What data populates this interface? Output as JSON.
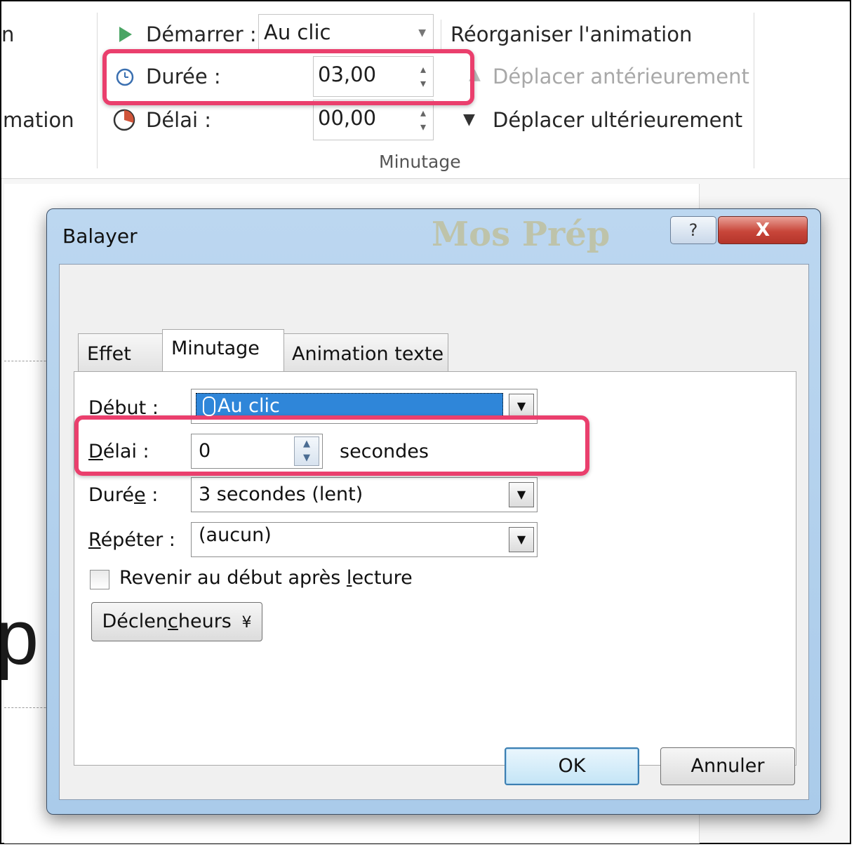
{
  "ribbon": {
    "left_group_label_partial": "n",
    "left_group_text_partial": "mation",
    "start_label": "Démarrer :",
    "start_value": "Au clic",
    "duration_label": "Durée :",
    "duration_value": "03,00",
    "delay_label": "Délai :",
    "delay_value": "00,00",
    "reorder_label": "Réorganiser l'animation",
    "move_earlier_label": "Déplacer antérieurement",
    "move_later_label": "Déplacer ultérieurement",
    "group_label": "Minutage"
  },
  "slide": {
    "partial_text": "p"
  },
  "dialog": {
    "title": "Balayer",
    "watermark": "Mos Prép",
    "help_label": "?",
    "close_label": "X",
    "tabs": [
      {
        "label": "Effet",
        "active": false
      },
      {
        "label": "Minutage",
        "active": true
      },
      {
        "label": "Animation texte",
        "active": false
      }
    ],
    "start": {
      "label_pre": "Dé",
      "label_ul": "b",
      "label_post": "ut :",
      "value": "Au clic"
    },
    "delay": {
      "label_pre": "",
      "label_ul": "D",
      "label_post": "élai :",
      "value": "0",
      "unit": "secondes"
    },
    "duration": {
      "label_pre": "Duré",
      "label_ul": "e",
      "label_post": " :",
      "value": "3 secondes (lent)"
    },
    "repeat": {
      "label_pre": "",
      "label_ul": "R",
      "label_post": "épéter :",
      "value": "(aucun)"
    },
    "rewind": {
      "label_pre": "Revenir au début après ",
      "label_ul": "l",
      "label_post": "ecture",
      "checked": false
    },
    "triggers": {
      "label_pre": "Déclen",
      "label_ul": "c",
      "label_post": "heurs",
      "icon": "¥"
    },
    "ok_label": "OK",
    "cancel_label": "Annuler"
  },
  "colors": {
    "highlight": "#ea3f6d",
    "selection": "#2f86d9",
    "play_green": "#4aa564"
  }
}
